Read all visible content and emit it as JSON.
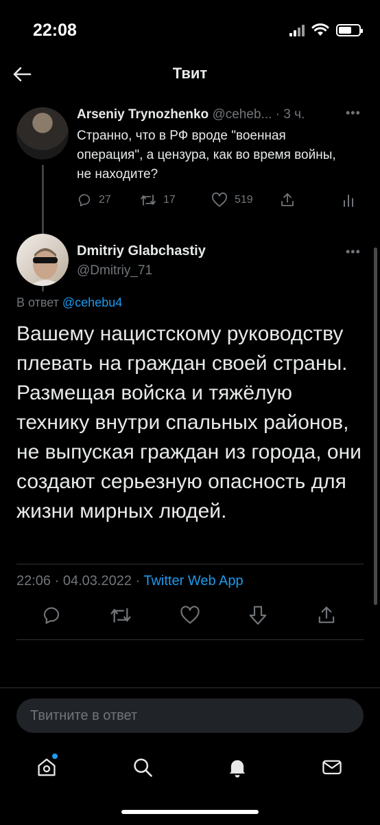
{
  "status_bar": {
    "time": "22:08"
  },
  "header": {
    "title": "Твит",
    "back_icon": "arrow-left-icon"
  },
  "parent_tweet": {
    "author_name": "Arseniy Trynozhenko",
    "author_handle": "@ceheb...",
    "separator": "·",
    "time_ago": "3 ч.",
    "text": "Странно, что в РФ вроде \"военная операция\", а цензура, как во время войны, не находите?",
    "replies": "27",
    "retweets": "17",
    "likes": "519"
  },
  "main_tweet": {
    "author_name": "Dmitriy Glabchastiy",
    "author_handle": "@Dmitriy_71",
    "reply_prefix": "В ответ ",
    "reply_to": "@cehebu4",
    "text": "Вашему нацистскому руководству плевать на граждан своей страны. Размещая войска и тяжёлую технику внутри спальных районов, не выпуская граждан из города, они создают серьезную опасность для жизни мирных людей.",
    "time": "22:06",
    "meta_separator": " · ",
    "date": "04.03.2022",
    "source": "Twitter Web App"
  },
  "reply_box": {
    "placeholder": "Твитните в ответ"
  },
  "colors": {
    "background": "#000000",
    "text": "#e7e9ea",
    "muted": "#71767b",
    "accent": "#1d9bf0",
    "divider": "#2f3336"
  }
}
